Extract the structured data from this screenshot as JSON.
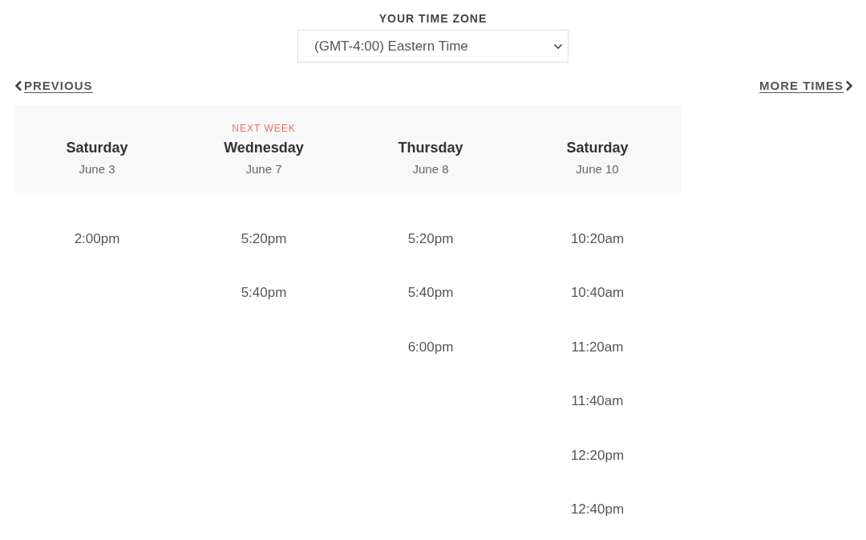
{
  "time_zone": {
    "label": "YOUR TIME ZONE",
    "value": "(GMT-4:00) Eastern Time"
  },
  "navigation": {
    "previous": "PREVIOUS",
    "next": "MORE TIMES"
  },
  "days": [
    {
      "day": "Saturday",
      "date": "June 3",
      "times": [
        "2:00pm"
      ]
    },
    {
      "note": "NEXT WEEK",
      "day": "Wednesday",
      "date": "June 7",
      "times": [
        "5:20pm",
        "5:40pm"
      ]
    },
    {
      "day": "Thursday",
      "date": "June 8",
      "times": [
        "5:20pm",
        "5:40pm",
        "6:00pm"
      ]
    },
    {
      "day": "Saturday",
      "date": "June 10",
      "times": [
        "10:20am",
        "10:40am",
        "11:20am",
        "11:40am",
        "12:20pm",
        "12:40pm"
      ]
    }
  ]
}
